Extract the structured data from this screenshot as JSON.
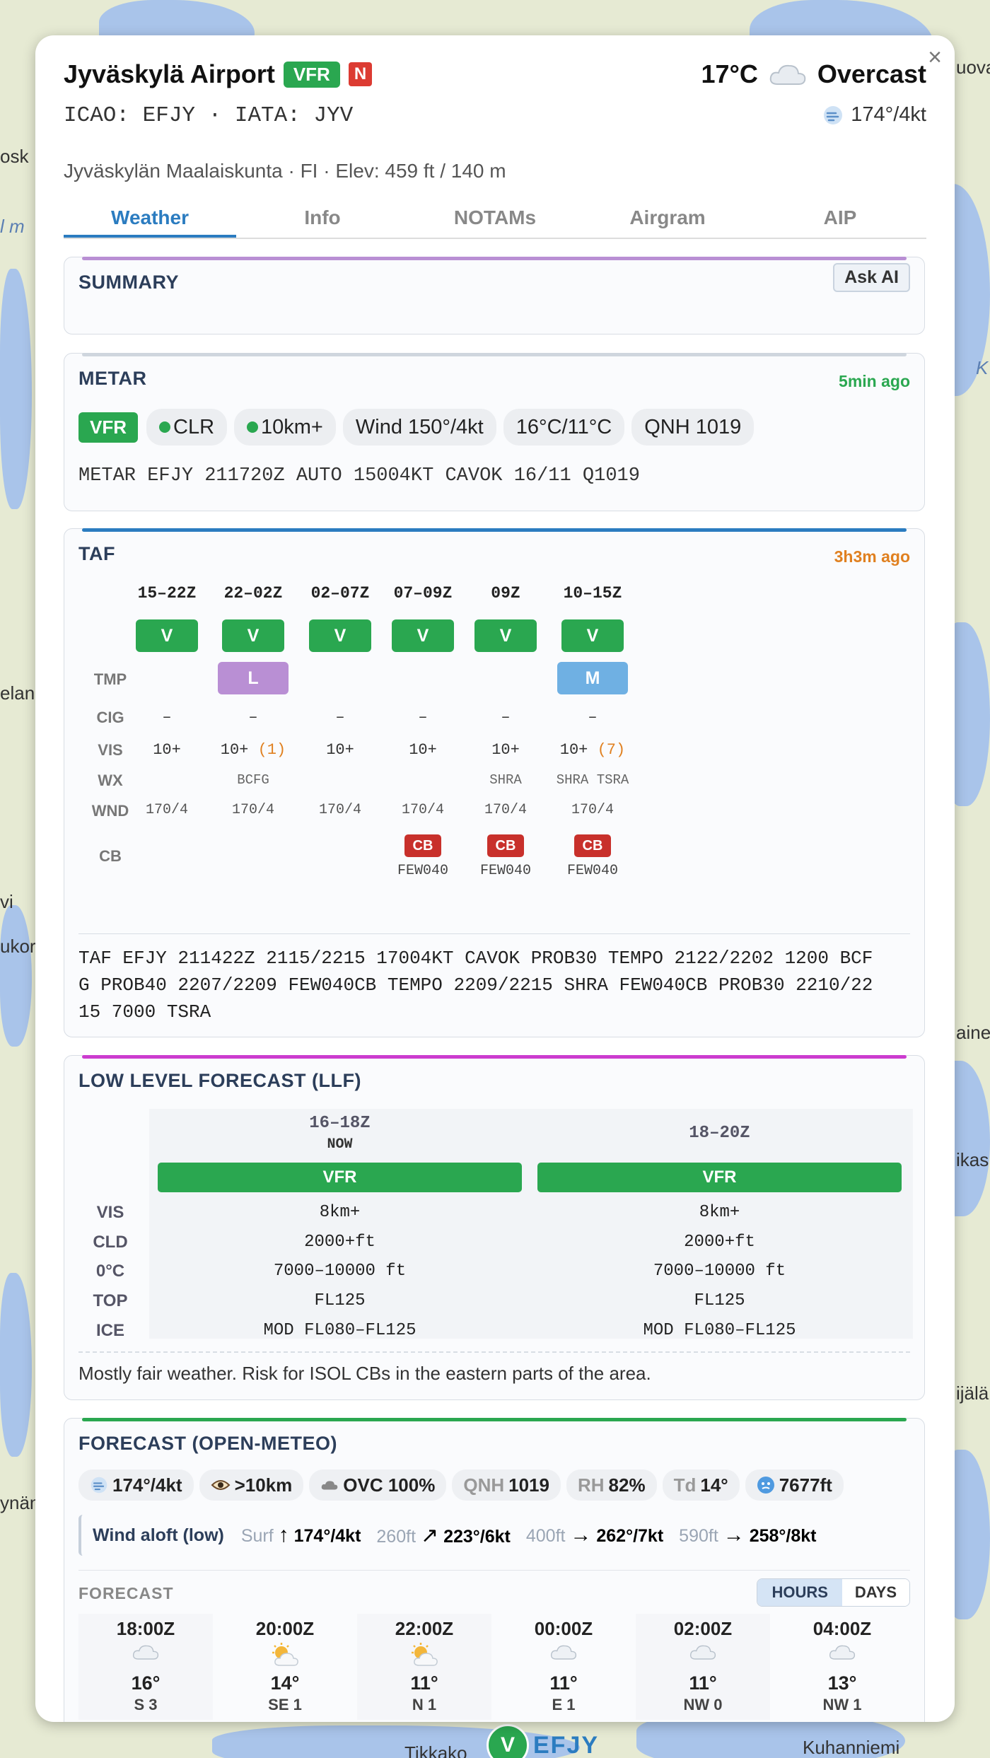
{
  "map": {
    "labels": [
      "osk",
      "l m",
      "elan",
      "vi",
      "ukor",
      "uova",
      "K",
      "aine",
      "ikas",
      "ijälä",
      "ynäm",
      "Tikkako",
      "Kuhanniemi"
    ],
    "marker": {
      "badge": "V",
      "code": "EFJY"
    }
  },
  "header": {
    "name": "Jyväskylä Airport",
    "flight_rule": "VFR",
    "flag": "N",
    "codes": "ICAO: EFJY · IATA: JYV",
    "location": "Jyväskylän Maalaiskunta · FI · Elev: 459 ft / 140 m",
    "temp": "17°C",
    "condition": "Overcast",
    "wind": "174°/4kt"
  },
  "tabs": [
    "Weather",
    "Info",
    "NOTAMs",
    "Airgram",
    "AIP"
  ],
  "summary": {
    "title": "SUMMARY",
    "ask_ai": "Ask AI"
  },
  "metar": {
    "title": "METAR",
    "age": "5min ago",
    "rule": "VFR",
    "pills": [
      "CLR",
      "10km+",
      "Wind 150°/4kt",
      "16°C/11°C",
      "QNH 1019"
    ],
    "raw": "METAR EFJY 211720Z AUTO 15004KT CAVOK 16/11 Q1019"
  },
  "taf": {
    "title": "TAF",
    "age": "3h3m ago",
    "row_labels": {
      "tmp": "TMP",
      "cig": "CIG",
      "vis": "VIS",
      "wx": "WX",
      "wnd": "WND",
      "cb": "CB"
    },
    "periods": [
      {
        "time": "15–22Z",
        "cat": "V",
        "tmp": "",
        "cig": "–",
        "vis": "10+",
        "vis_note": "",
        "wx": "",
        "wnd": "170/4",
        "cb": "",
        "cb_layer": ""
      },
      {
        "time": "22–02Z",
        "cat": "V",
        "tmp": "L",
        "cig": "–",
        "vis": "10+",
        "vis_note": "(1)",
        "wx": "BCFG",
        "wnd": "170/4",
        "cb": "",
        "cb_layer": ""
      },
      {
        "time": "02–07Z",
        "cat": "V",
        "tmp": "",
        "cig": "–",
        "vis": "10+",
        "vis_note": "",
        "wx": "",
        "wnd": "170/4",
        "cb": "",
        "cb_layer": ""
      },
      {
        "time": "07–09Z",
        "cat": "V",
        "tmp": "",
        "cig": "–",
        "vis": "10+",
        "vis_note": "",
        "wx": "",
        "wnd": "170/4",
        "cb": "CB",
        "cb_layer": "FEW040"
      },
      {
        "time": "09Z",
        "cat": "V",
        "tmp": "",
        "cig": "–",
        "vis": "10+",
        "vis_note": "",
        "wx": "SHRA",
        "wnd": "170/4",
        "cb": "CB",
        "cb_layer": "FEW040"
      },
      {
        "time": "10–15Z",
        "cat": "V",
        "tmp": "M",
        "cig": "–",
        "vis": "10+",
        "vis_note": "(7)",
        "wx": "SHRA TSRA",
        "wnd": "170/4",
        "cb": "CB",
        "cb_layer": "FEW040"
      }
    ],
    "raw_lines": [
      "TAF EFJY 211422Z 2115/2215 17004KT CAVOK PROB30 TEMPO 2122/2202 1200 BCF",
      "G PROB40 2207/2209 FEW040CB TEMPO 2209/2215 SHRA FEW040CB PROB30 2210/22",
      "15 7000 TSRA"
    ]
  },
  "llf": {
    "title": "LOW LEVEL FORECAST (LLF)",
    "labels": [
      "VIS",
      "CLD",
      "0°C",
      "TOP",
      "ICE"
    ],
    "periods": [
      {
        "time": "16–18Z",
        "now": "NOW",
        "rule": "VFR",
        "values": [
          "8km+",
          "2000+ft",
          "7000–10000 ft",
          "FL125",
          "MOD FL080–FL125"
        ]
      },
      {
        "time": "18–20Z",
        "now": "",
        "rule": "VFR",
        "values": [
          "8km+",
          "2000+ft",
          "7000–10000 ft",
          "FL125",
          "MOD FL080–FL125"
        ]
      }
    ],
    "note": "Mostly fair weather. Risk for ISOL CBs in the eastern parts of the area."
  },
  "forecast": {
    "title": "FORECAST (OPEN-METEO)",
    "pills": [
      {
        "icon": "wind-icon",
        "key": "",
        "value": "174°/4kt"
      },
      {
        "icon": "eye-icon",
        "key": "",
        "value": ">10km"
      },
      {
        "icon": "cloud-icon",
        "key": "",
        "value": "OVC 100%"
      },
      {
        "icon": "",
        "key": "QNH",
        "value": "1019"
      },
      {
        "icon": "",
        "key": "RH",
        "value": "82%"
      },
      {
        "icon": "",
        "key": "Td",
        "value": "14°"
      },
      {
        "icon": "freezing-icon",
        "key": "",
        "value": "7677ft"
      }
    ],
    "aloft": {
      "label": "Wind aloft (low)",
      "levels": [
        {
          "alt": "Surf",
          "arrow": "↑",
          "value": "174°/4kt"
        },
        {
          "alt": "260ft",
          "arrow": "↗",
          "value": "223°/6kt"
        },
        {
          "alt": "400ft",
          "arrow": "→",
          "value": "262°/7kt"
        },
        {
          "alt": "590ft",
          "arrow": "→",
          "value": "258°/8kt"
        }
      ]
    },
    "sub_title": "FORECAST",
    "toggle": {
      "hours": "HOURS",
      "days": "DAYS"
    },
    "hours": [
      {
        "time": "18:00Z",
        "icon": "cloud-icon",
        "temp": "16°",
        "wind": "S 3"
      },
      {
        "time": "20:00Z",
        "icon": "partly-sunny-icon",
        "temp": "14°",
        "wind": "SE 1"
      },
      {
        "time": "22:00Z",
        "icon": "partly-sunny-icon",
        "temp": "11°",
        "wind": "N 1"
      },
      {
        "time": "00:00Z",
        "icon": "cloud-icon",
        "temp": "11°",
        "wind": "E 1"
      },
      {
        "time": "02:00Z",
        "icon": "cloud-icon",
        "temp": "11°",
        "wind": "NW 0"
      },
      {
        "time": "04:00Z",
        "icon": "cloud-icon",
        "temp": "13°",
        "wind": "NW 1"
      }
    ]
  },
  "colors": {
    "vfr": "#2aa750",
    "accent": "#2b7cc0",
    "cb": "#c8302b",
    "tmp_l": "#b98fd4",
    "tmp_m": "#6fb0e3"
  }
}
